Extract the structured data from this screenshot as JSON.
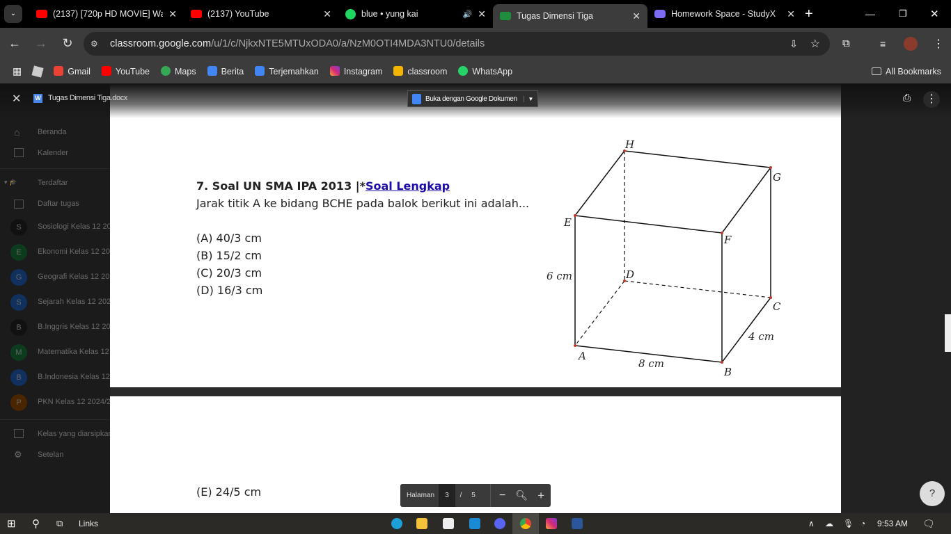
{
  "browser": {
    "tabs": [
      {
        "title": "(2137) [720p HD MOVIE] Wa",
        "icon": "youtube-icon",
        "color": "#ff0000"
      },
      {
        "title": "(2137) YouTube",
        "icon": "youtube-icon",
        "color": "#ff0000"
      },
      {
        "title": "blue • yung kai",
        "icon": "spotify-icon",
        "color": "#1ed760"
      },
      {
        "title": "Tugas Dimensi Tiga",
        "icon": "classroom-icon",
        "color": "#1e8e3e",
        "active": true
      },
      {
        "title": "Homework Space - StudyX",
        "icon": "studyx-icon",
        "color": "#7c6cf0"
      }
    ],
    "url_host": "classroom.google.com",
    "url_path": "/u/1/c/NjkxNTE5MTUxODA0/a/NzM0OTI4MDA3NTU0/details",
    "bookmarks": [
      "Gmail",
      "YouTube",
      "Maps",
      "Berita",
      "Terjemahkan",
      "Instagram",
      "classroom",
      "WhatsApp"
    ],
    "all_bookmarks": "All Bookmarks"
  },
  "sidebar": {
    "items": [
      "Beranda",
      "Kalender",
      "Terdaftar",
      "Daftar tugas"
    ],
    "classes": [
      {
        "letter": "S",
        "name": "Sosiologi Kelas 12 20",
        "color": "#111"
      },
      {
        "letter": "E",
        "name": "Ekonomi Kelas 12 20",
        "color": "#0d3b1e"
      },
      {
        "letter": "G",
        "name": "Geografi Kelas 12 20",
        "color": "#10305e"
      },
      {
        "letter": "S",
        "name": "Sejarah Kelas 12 202",
        "color": "#10305e"
      },
      {
        "letter": "B",
        "name": "B.Inggris Kelas 12 20",
        "color": "#111"
      },
      {
        "letter": "M",
        "name": "Matematika Kelas 12",
        "color": "#0d3b1e"
      },
      {
        "letter": "B",
        "name": "B.Indonesia Kelas 12",
        "color": "#10305e"
      },
      {
        "letter": "P",
        "name": "PKN Kelas 12 2024/2",
        "color": "#4a2600"
      }
    ],
    "archived": "Kelas yang diarsipkan",
    "settings": "Setelan"
  },
  "viewer": {
    "filename": "Tugas Dimensi Tiga.docx",
    "open_with": "Buka dengan Google Dokumen",
    "page_label": "Halaman",
    "page_current": "3",
    "page_sep": "/",
    "page_total": "5"
  },
  "document": {
    "heading": "7. Soal UN SMA IPA 2013 |*",
    "link": "Soal Lengkap",
    "question": "Jarak titik A ke bidang BCHE pada balok berikut ini adalah...",
    "options": [
      "(A) 40/3 cm",
      "(B) 15/2 cm",
      "(C) 20/3 cm",
      "(D) 16/3 cm"
    ],
    "option_e": "(E) 24/5 cm",
    "figure": {
      "vertices": [
        "A",
        "B",
        "C",
        "D",
        "E",
        "F",
        "G",
        "H"
      ],
      "labels": {
        "height": "6 cm",
        "length": "8 cm",
        "width": "4 cm"
      }
    }
  },
  "taskbar": {
    "search_label": "Links",
    "time": "9:53 AM"
  }
}
